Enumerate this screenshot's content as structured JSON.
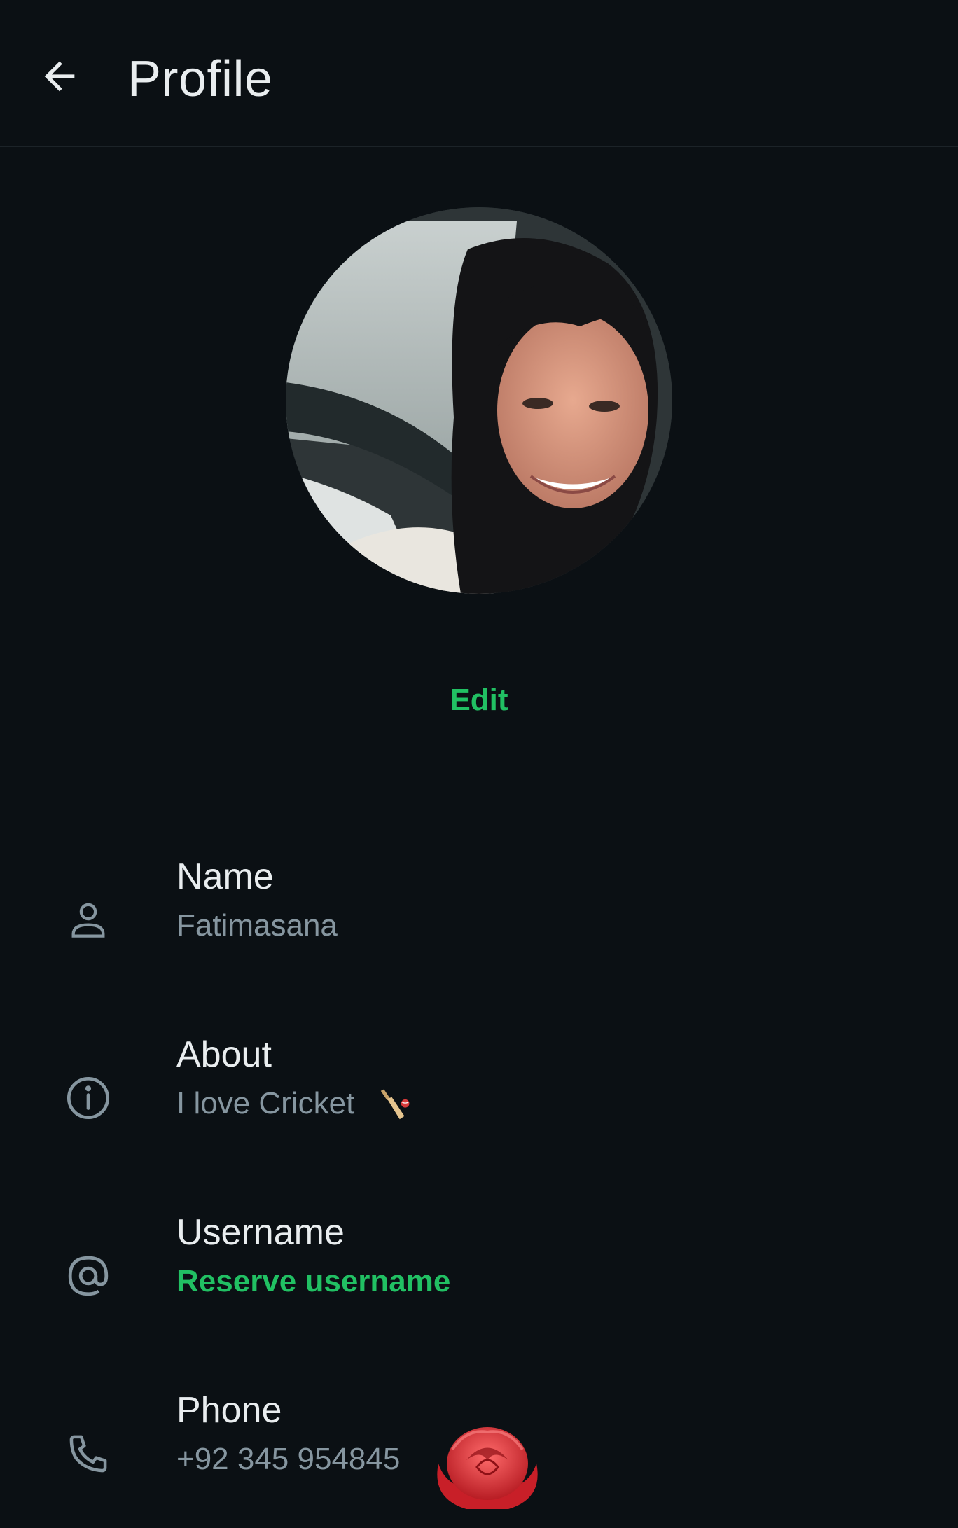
{
  "header": {
    "title": "Profile"
  },
  "profile": {
    "edit_label": "Edit"
  },
  "fields": [
    {
      "label": "Name",
      "value": "Fatimasana",
      "icon": "person-icon"
    },
    {
      "label": "About",
      "value": "I love Cricket",
      "icon": "info-icon",
      "emoji": "cricket-bat-emoji"
    },
    {
      "label": "Username",
      "value": "Reserve username",
      "icon": "at-sign-icon"
    },
    {
      "label": "Phone",
      "value": "+92 345 954845",
      "icon": "phone-icon",
      "overlay": "rose-sticker"
    }
  ],
  "colors": {
    "background": "#0b1014",
    "accent": "#21c063",
    "secondary_text": "#8696a0",
    "primary_text": "#e9edef"
  }
}
